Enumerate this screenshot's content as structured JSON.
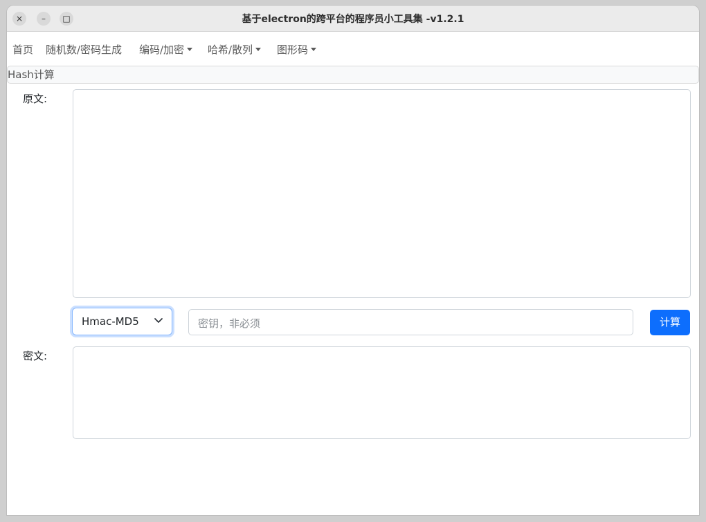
{
  "window": {
    "title": "基于electron的跨平台的程序员小工具集 -v1.2.1",
    "controls": {
      "close": "×",
      "minimize": "–",
      "maximize": "□"
    }
  },
  "navbar": {
    "items": [
      {
        "label": "首页",
        "dropdown": false
      },
      {
        "label": "随机数/密码生成",
        "dropdown": false
      },
      {
        "label": "编码/加密",
        "dropdown": true
      },
      {
        "label": "哈希/散列",
        "dropdown": true
      },
      {
        "label": "图形码",
        "dropdown": true
      }
    ]
  },
  "breadcrumb": {
    "label": "Hash计算"
  },
  "form": {
    "plaintext_label": "原文:",
    "plaintext_value": "",
    "algorithm_selected": "Hmac-MD5",
    "key_placeholder": "密钥，非必须",
    "key_value": "",
    "compute_label": "计算",
    "ciphertext_label": "密文:",
    "ciphertext_value": ""
  },
  "colors": {
    "accent": "#0d6efd",
    "border": "#ced4da",
    "focus": "#86b7fe"
  }
}
